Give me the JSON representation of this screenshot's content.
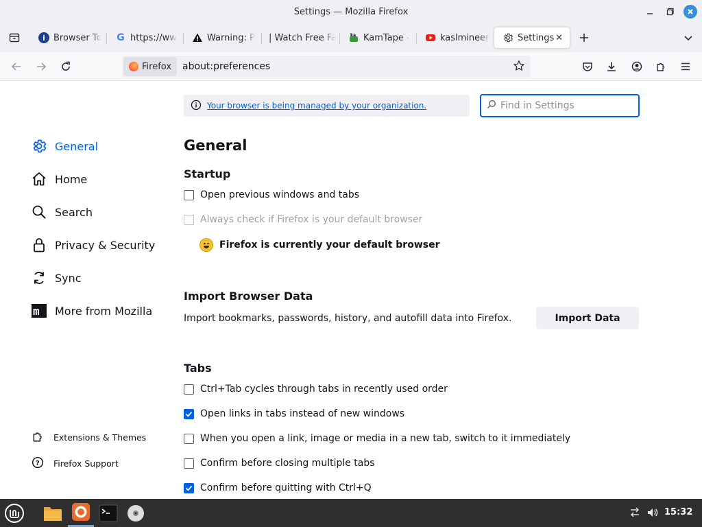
{
  "window": {
    "title": "Settings — Mozilla Firefox"
  },
  "tabs": [
    {
      "label": "Browser Te",
      "icon": "info-icon"
    },
    {
      "label": "https://ww",
      "icon": "google-icon"
    },
    {
      "label": "Warning: P",
      "icon": "warning-icon"
    },
    {
      "label": "| Watch Free Fa",
      "icon": "none"
    },
    {
      "label": "KamTape - ",
      "icon": "kamtape-icon"
    },
    {
      "label": "kaslmineer",
      "icon": "youtube-icon"
    },
    {
      "label": "Settings",
      "icon": "gear-icon",
      "active": true
    }
  ],
  "navbar": {
    "identity_label": "Firefox",
    "url": "about:preferences"
  },
  "sidebar": {
    "categories": [
      {
        "label": "General",
        "icon": "gear-icon",
        "selected": true
      },
      {
        "label": "Home",
        "icon": "home-icon"
      },
      {
        "label": "Search",
        "icon": "search-icon"
      },
      {
        "label": "Privacy & Security",
        "icon": "lock-icon"
      },
      {
        "label": "Sync",
        "icon": "sync-icon"
      },
      {
        "label": "More from Mozilla",
        "icon": "mozilla-icon"
      }
    ],
    "footer": [
      {
        "label": "Extensions & Themes",
        "icon": "puzzle-icon"
      },
      {
        "label": "Firefox Support",
        "icon": "help-icon"
      }
    ]
  },
  "main": {
    "policy_notice": "Your browser is being managed by your organization.",
    "search_placeholder": "Find in Settings",
    "pane_title": "General",
    "startup": {
      "heading": "Startup",
      "open_previous": {
        "label": "Open previous windows and tabs",
        "checked": false
      },
      "always_check_default": {
        "label": "Always check if Firefox is your default browser",
        "checked": false,
        "disabled": true
      },
      "default_status": "Firefox is currently your default browser"
    },
    "import": {
      "heading": "Import Browser Data",
      "description": "Import bookmarks, passwords, history, and autofill data into Firefox.",
      "button_label": "Import Data"
    },
    "tabs_section": {
      "heading": "Tabs",
      "options": [
        {
          "label": "Ctrl+Tab cycles through tabs in recently used order",
          "checked": false
        },
        {
          "label": "Open links in tabs instead of new windows",
          "checked": true
        },
        {
          "label": "When you open a link, image or media in a new tab, switch to it immediately",
          "checked": false
        },
        {
          "label": "Confirm before closing multiple tabs",
          "checked": false
        },
        {
          "label": "Confirm before quitting with Ctrl+Q",
          "checked": true
        }
      ]
    }
  },
  "taskbar": {
    "clock": "15:32",
    "items": [
      "mint-menu-icon",
      "files-icon",
      "firefox-icon",
      "terminal-icon",
      "disc-icon"
    ]
  },
  "colors": {
    "accent": "#0061e0",
    "chrome": "#f0f0f4",
    "taskbar": "#2f2f2f"
  }
}
